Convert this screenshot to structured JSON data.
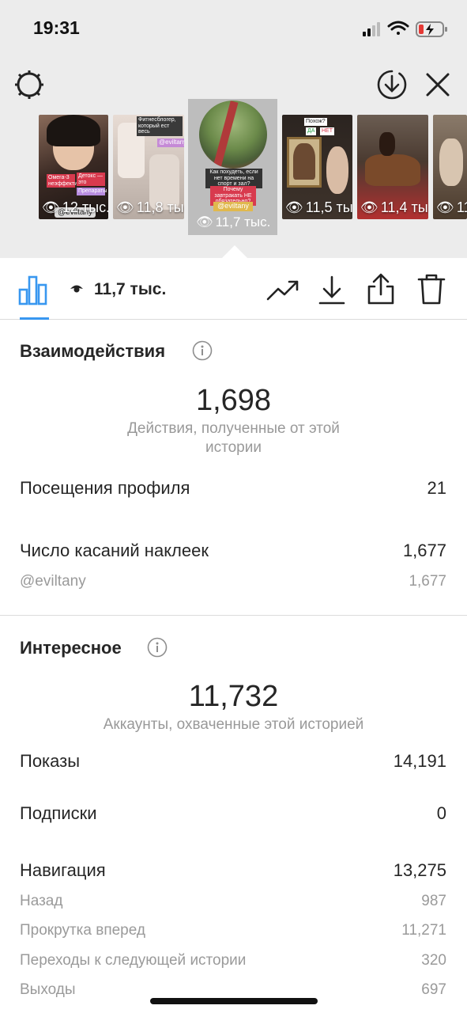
{
  "status_bar": {
    "time": "19:31"
  },
  "header": {
    "left_icon": "gear-icon",
    "right_icons": [
      "download-circle-icon",
      "close-icon"
    ]
  },
  "stories": [
    {
      "views": "12 тыс.",
      "handle": "@eviltany",
      "stickers": [
        "Омега-3 неэффективна",
        "Детокс — это",
        "Препараты"
      ]
    },
    {
      "views": "11,8 тыс.",
      "handle": "",
      "stickers": [
        "Фитнесблогер, который ест весь",
        "@eviltany"
      ]
    },
    {
      "views": "11,7 тыс.",
      "handle": "",
      "stickers": [
        "Как похудеть, если нет времени на спорт и зал?",
        "Почему завтракать НЕ обязательно?",
        "@eviltany"
      ]
    },
    {
      "views": "11,5 тыс.",
      "handle": "",
      "stickers": [
        "Похож?",
        "ДА",
        "НЕТ"
      ]
    },
    {
      "views": "11,4 тыс.",
      "handle": "",
      "stickers": []
    },
    {
      "views": "11,",
      "handle": "",
      "stickers": []
    }
  ],
  "toolbar": {
    "views": "11,7 тыс.",
    "icons": [
      "bar-chart-icon",
      "eye-icon",
      "trending-icon",
      "download-icon",
      "share-icon",
      "trash-icon"
    ]
  },
  "interactions": {
    "title": "Взаимодействия",
    "total": "1,698",
    "caption": "Действия, полученные от этой истории",
    "rows": [
      {
        "label": "Посещения профиля",
        "value": "21"
      },
      {
        "label": "Число касаний наклеек",
        "value": "1,677"
      }
    ],
    "sub_rows": [
      {
        "label": "@eviltany",
        "value": "1,677"
      }
    ]
  },
  "discovery": {
    "title": "Интересное",
    "total": "11,732",
    "caption": "Аккаунты, охваченные этой историей",
    "rows": [
      {
        "label": "Показы",
        "value": "14,191"
      },
      {
        "label": "Подписки",
        "value": "0"
      },
      {
        "label": "Навигация",
        "value": "13,275"
      }
    ],
    "sub_rows": [
      {
        "label": "Назад",
        "value": "987"
      },
      {
        "label": "Прокрутка вперед",
        "value": "11,271"
      },
      {
        "label": "Переходы к следующей истории",
        "value": "320"
      },
      {
        "label": "Выходы",
        "value": "697"
      }
    ]
  },
  "colors": {
    "accent": "#3897f0",
    "top_background": "#ececec",
    "muted_text": "#999999"
  }
}
